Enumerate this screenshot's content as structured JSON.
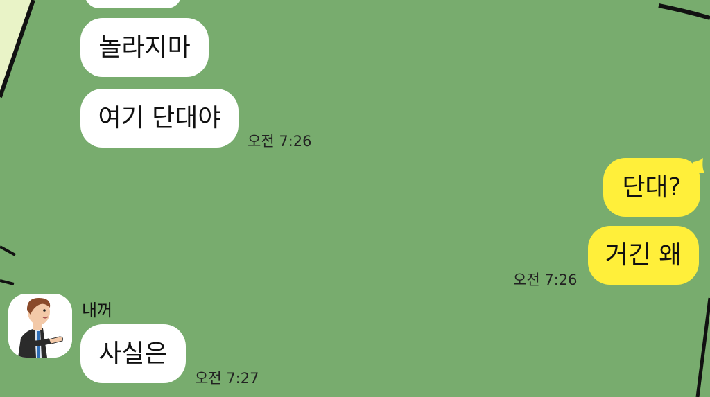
{
  "conversation": {
    "incoming_block_1": {
      "messages": [
        "놀라지마",
        "여기 단대야"
      ],
      "time": "오전 7:26"
    },
    "outgoing_block": {
      "messages": [
        "단대?",
        "거긴 왜"
      ],
      "time": "오전 7:26"
    },
    "incoming_block_2": {
      "sender": "내꺼",
      "messages": [
        "사실은"
      ],
      "time": "오전 7:27"
    }
  },
  "colors": {
    "chat_background": "#78ac6e",
    "incoming_bubble": "#ffffff",
    "outgoing_bubble": "#ffef3a"
  },
  "icons": [
    "avatar-man-in-suit"
  ]
}
